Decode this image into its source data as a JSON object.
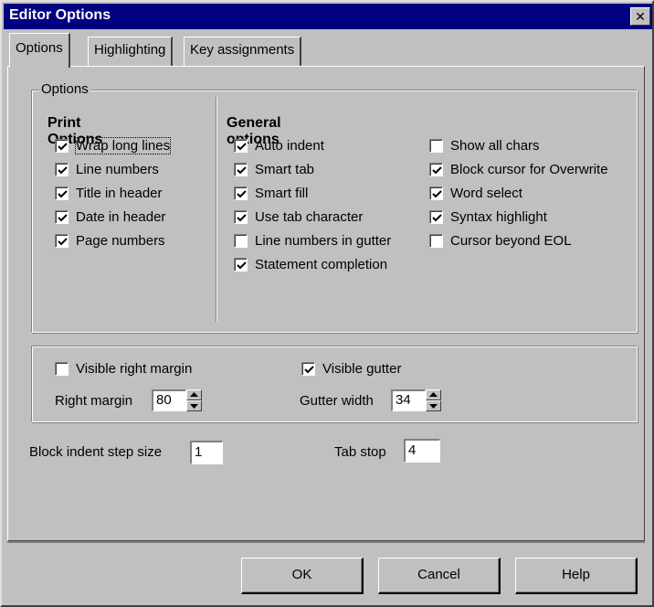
{
  "window": {
    "title": "Editor Options",
    "close_glyph": "✕"
  },
  "tabs": [
    {
      "label": "Options",
      "active": true
    },
    {
      "label": "Highlighting",
      "active": false
    },
    {
      "label": "Key assignments",
      "active": false
    }
  ],
  "options_group": {
    "legend": "Options",
    "print_options": {
      "heading": "Print Options",
      "items": [
        {
          "label": "Wrap long lines",
          "checked": true
        },
        {
          "label": "Line numbers",
          "checked": true
        },
        {
          "label": "Title in header",
          "checked": true
        },
        {
          "label": "Date in header",
          "checked": true
        },
        {
          "label": "Page numbers",
          "checked": true
        }
      ]
    },
    "general_options": {
      "heading": "General options",
      "column1": [
        {
          "label": "Auto indent",
          "checked": true
        },
        {
          "label": "Smart tab",
          "checked": true
        },
        {
          "label": "Smart fill",
          "checked": true
        },
        {
          "label": "Use tab character",
          "checked": true
        },
        {
          "label": "Line numbers in gutter",
          "checked": false
        },
        {
          "label": "Statement completion",
          "checked": true
        }
      ],
      "column2": [
        {
          "label": "Show all chars",
          "checked": false
        },
        {
          "label": "Block cursor for Overwrite",
          "checked": true
        },
        {
          "label": "Word select",
          "checked": true
        },
        {
          "label": "Syntax highlight",
          "checked": true
        },
        {
          "label": "Cursor beyond EOL",
          "checked": false
        }
      ]
    }
  },
  "margins_group": {
    "visible_right_margin": {
      "label": "Visible right margin",
      "checked": false
    },
    "visible_gutter": {
      "label": "Visible gutter",
      "checked": true
    },
    "right_margin": {
      "label": "Right margin",
      "value": "80"
    },
    "gutter_width": {
      "label": "Gutter width",
      "value": "34"
    }
  },
  "block_indent": {
    "label": "Block indent step size",
    "value": "1"
  },
  "tab_stop": {
    "label": "Tab stop",
    "value": "4"
  },
  "buttons": {
    "ok": "OK",
    "cancel": "Cancel",
    "help": "Help"
  },
  "colors": {
    "face": "#c0c0c0",
    "title_bar": "#000080",
    "shadow": "#808080",
    "highlight": "#ffffff"
  }
}
